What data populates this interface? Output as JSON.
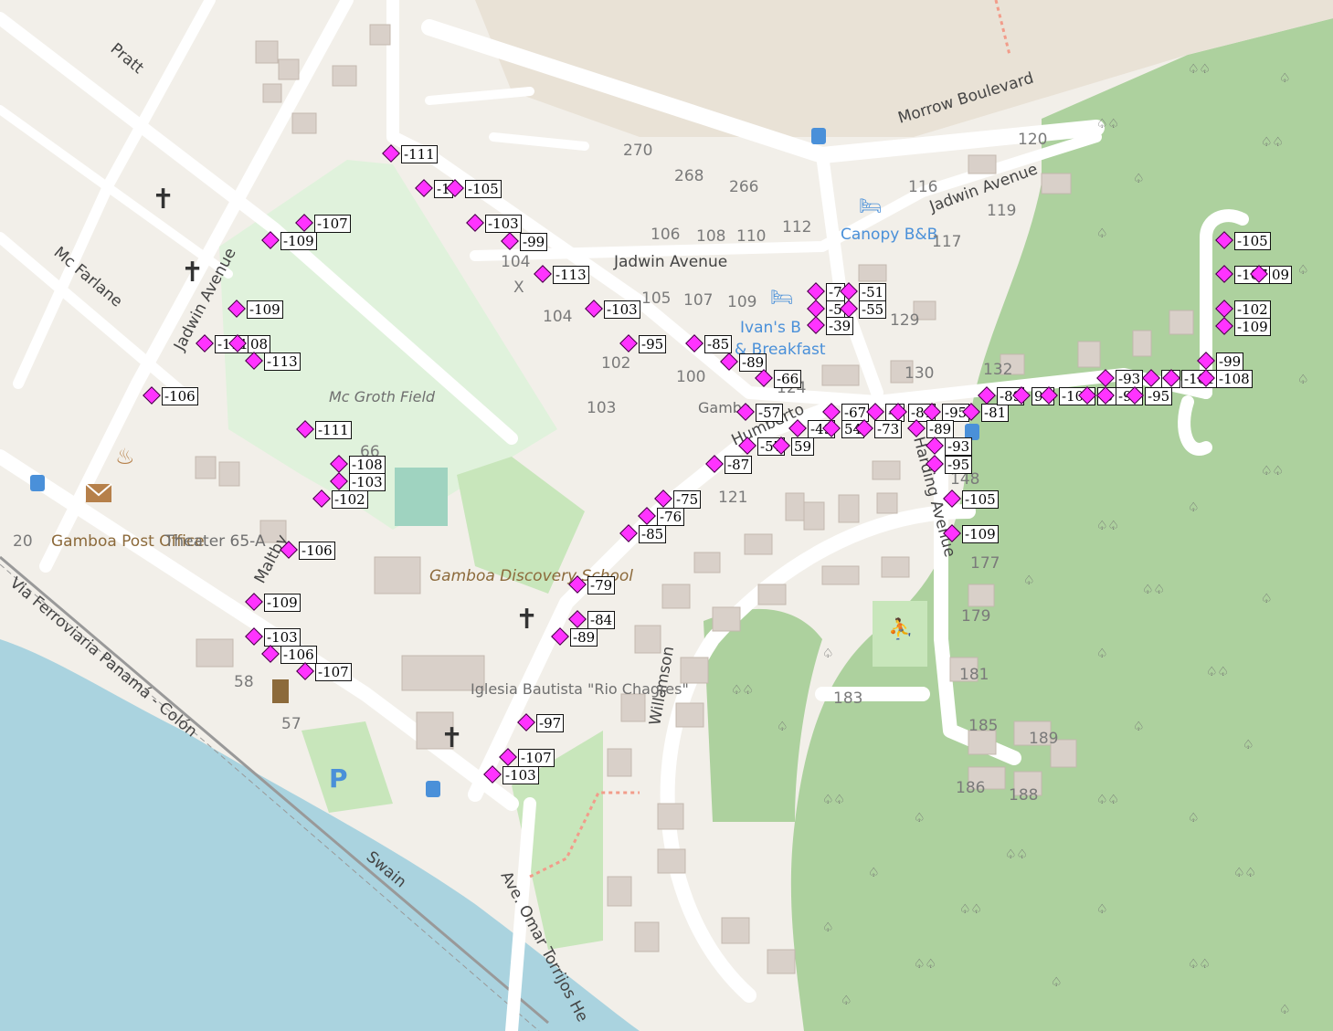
{
  "streets": {
    "morrow": "Morrow Boulevard",
    "jadwin_east_upper": "Jadwin Avenue",
    "jadwin_center": "Jadwin Avenue",
    "jadwin_west": "Jadwin Avenue",
    "pratt": "Pratt",
    "mcfarlane": "Mc Farlane",
    "maltby": "Maltby",
    "via_ferroviaria": "Via Ferroviaria Panamá - Colón",
    "swain": "Swain",
    "omar_torrijos": "Ave. Omar Torrijos He",
    "willamson": "Willamson",
    "harding": "Harding Avenue",
    "humberto": "Humberto"
  },
  "pois": {
    "canopy": "Canopy B&B",
    "ivans": "Ivan's B",
    "ivans2": "& Breakfast",
    "mcgroth": "Mc Groth Field",
    "post_office": "Gamboa Post Office",
    "theater": "Theater 65-A",
    "school": "Gamboa Discovery School",
    "iglesia": "Iglesia Bautista \"Rio Chagres\"",
    "gamboa_frag": "Gambo"
  },
  "house_numbers": [
    "270",
    "268",
    "266",
    "120",
    "116",
    "119",
    "106",
    "108",
    "110",
    "112",
    "117",
    "104",
    "104",
    "105",
    "107",
    "109",
    "129",
    "102",
    "100",
    "124",
    "103",
    "130",
    "132",
    "121",
    "148",
    "177",
    "179",
    "181",
    "183",
    "185",
    "189",
    "186",
    "188",
    "66",
    "58",
    "57",
    "20",
    "X"
  ],
  "markers": [
    {
      "id": "m1",
      "value": "-111"
    },
    {
      "id": "m2",
      "value": "-1"
    },
    {
      "id": "m3",
      "value": "-105"
    },
    {
      "id": "m4",
      "value": "-103"
    },
    {
      "id": "m5",
      "value": "-99"
    },
    {
      "id": "m6",
      "value": "-107"
    },
    {
      "id": "m7",
      "value": "-109"
    },
    {
      "id": "m8",
      "value": "-113"
    },
    {
      "id": "m9",
      "value": "-103"
    },
    {
      "id": "m10",
      "value": "-109"
    },
    {
      "id": "m11",
      "value": "-95"
    },
    {
      "id": "m12",
      "value": "-85"
    },
    {
      "id": "m13",
      "value": "-89"
    },
    {
      "id": "m14",
      "value": "-66"
    },
    {
      "id": "m15",
      "value": "-111"
    },
    {
      "id": "m16",
      "value": "08"
    },
    {
      "id": "m17",
      "value": "-113"
    },
    {
      "id": "m18",
      "value": "-106"
    },
    {
      "id": "m19",
      "value": "-111"
    },
    {
      "id": "m20",
      "value": "-108"
    },
    {
      "id": "m21",
      "value": "-103"
    },
    {
      "id": "m22",
      "value": "-102"
    },
    {
      "id": "m23",
      "value": "-106"
    },
    {
      "id": "m24",
      "value": "-109"
    },
    {
      "id": "m25",
      "value": "-103"
    },
    {
      "id": "m26",
      "value": "-106"
    },
    {
      "id": "m27",
      "value": "-107"
    },
    {
      "id": "m28",
      "value": "-7"
    },
    {
      "id": "m29",
      "value": "-51"
    },
    {
      "id": "m30",
      "value": "-5"
    },
    {
      "id": "m31",
      "value": "-55"
    },
    {
      "id": "m32",
      "value": "-39"
    },
    {
      "id": "m33",
      "value": "-57"
    },
    {
      "id": "m34",
      "value": "-67"
    },
    {
      "id": "m35",
      "value": "-7"
    },
    {
      "id": "m36",
      "value": "-81"
    },
    {
      "id": "m37",
      "value": "-95"
    },
    {
      "id": "m38",
      "value": "-49"
    },
    {
      "id": "m39",
      "value": "54"
    },
    {
      "id": "m40",
      "value": "-73"
    },
    {
      "id": "m41",
      "value": "-89"
    },
    {
      "id": "m42",
      "value": "-57"
    },
    {
      "id": "m43",
      "value": "59"
    },
    {
      "id": "m44",
      "value": "-87"
    },
    {
      "id": "m45",
      "value": "-93"
    },
    {
      "id": "m46",
      "value": "-95"
    },
    {
      "id": "m47",
      "value": "-105"
    },
    {
      "id": "m48",
      "value": "-109"
    },
    {
      "id": "m49",
      "value": "-75"
    },
    {
      "id": "m50",
      "value": "-76"
    },
    {
      "id": "m51",
      "value": "-85"
    },
    {
      "id": "m52",
      "value": "-79"
    },
    {
      "id": "m53",
      "value": "-84"
    },
    {
      "id": "m54",
      "value": "-89"
    },
    {
      "id": "m55",
      "value": "-97"
    },
    {
      "id": "m56",
      "value": "-107"
    },
    {
      "id": "m57",
      "value": "-103"
    },
    {
      "id": "m58",
      "value": "-81"
    },
    {
      "id": "m59",
      "value": "-89"
    },
    {
      "id": "m60",
      "value": "96"
    },
    {
      "id": "m61",
      "value": "-103"
    },
    {
      "id": "m62",
      "value": "-9"
    },
    {
      "id": "m63",
      "value": "-99"
    },
    {
      "id": "m64",
      "value": "-93"
    },
    {
      "id": "m65",
      "value": "-9"
    },
    {
      "id": "m66",
      "value": "-101"
    },
    {
      "id": "m67",
      "value": "-108"
    },
    {
      "id": "m68",
      "value": "-95"
    },
    {
      "id": "m69",
      "value": "-99"
    },
    {
      "id": "m70",
      "value": "-105"
    },
    {
      "id": "m71",
      "value": "-107"
    },
    {
      "id": "m72",
      "value": "09"
    },
    {
      "id": "m73",
      "value": "-102"
    },
    {
      "id": "m74",
      "value": "-109"
    }
  ]
}
